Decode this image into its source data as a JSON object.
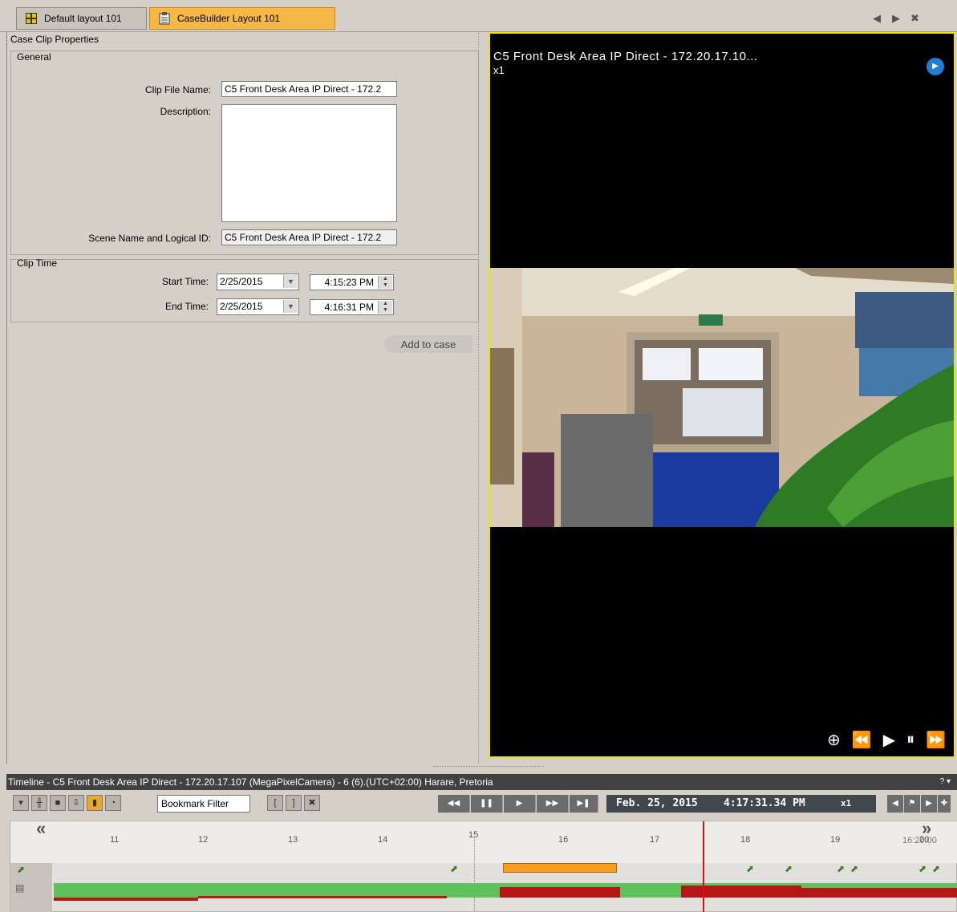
{
  "tabs": [
    {
      "label": "Default layout 101"
    },
    {
      "label": "CaseBuilder Layout 101"
    }
  ],
  "tab_nav": {
    "prev": "◀",
    "next": "▶",
    "close": "✖"
  },
  "case_clip": {
    "title": "Case Clip Properties",
    "general": {
      "legend": "General",
      "clip_file_name_label": "Clip File Name:",
      "clip_file_name_value": "C5 Front Desk Area IP Direct - 172.2",
      "description_label": "Description:",
      "description_value": "",
      "scene_label": "Scene Name and Logical ID:",
      "scene_value": "C5 Front Desk Area IP Direct - 172.2"
    },
    "clip_time": {
      "legend": "Clip Time",
      "start_label": "Start Time:",
      "start_date": "2/25/2015",
      "start_time": "4:15:23 PM",
      "end_label": "End Time:",
      "end_date": "2/25/2015",
      "end_time": "4:16:31 PM"
    },
    "add_to_case": "Add to case"
  },
  "video": {
    "title": "C5 Front Desk Area IP Direct - 172.20.17.10...",
    "speed": "x1"
  },
  "timeline": {
    "header": "Timeline - C5 Front Desk Area IP Direct - 172.20.17.107 (MegaPixelCamera) - 6 (6).(UTC+02:00) Harare, Pretoria",
    "help": "? ▾",
    "bookmark_filter": "Bookmark Filter",
    "date": "Feb. 25, 2015",
    "time": "4:17:31.34 PM",
    "speed": "x1",
    "right_time_label": "16:20:00",
    "ticks": [
      "11",
      "12",
      "13",
      "14",
      "15",
      "16",
      "17",
      "18",
      "19",
      "20"
    ]
  },
  "colors": {
    "active_tab": "#f5b845",
    "video_border": "#e9e310",
    "timeline_green": "#5fc15a",
    "timeline_red": "#b81616",
    "now_marker": "#e01010"
  }
}
